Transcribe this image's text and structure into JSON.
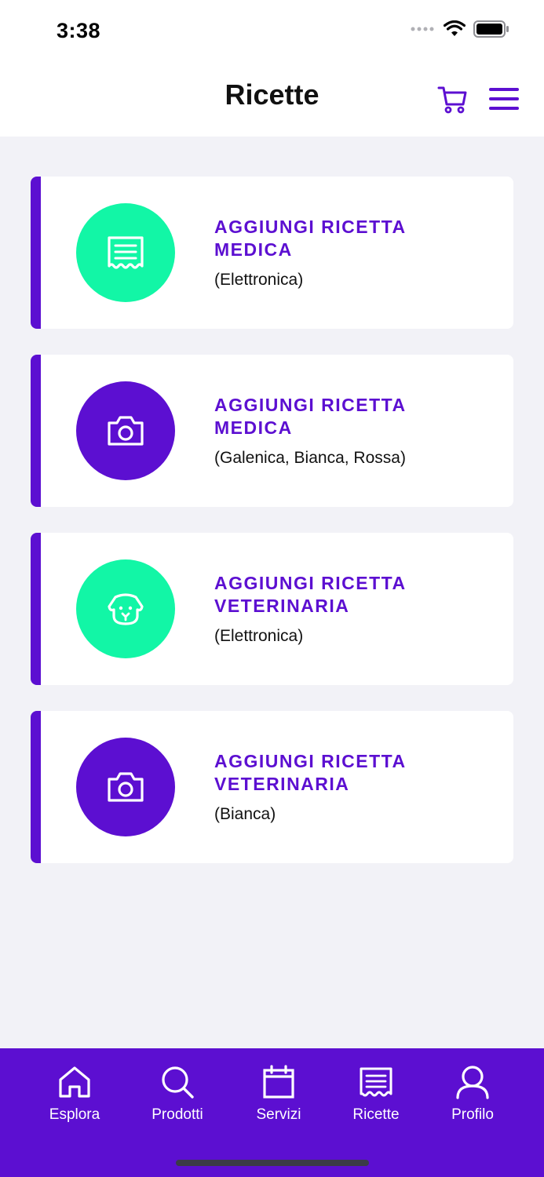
{
  "status_bar": {
    "time": "3:38"
  },
  "header": {
    "title": "Ricette",
    "cart_icon": "cart-icon",
    "menu_icon": "hamburger-menu-icon"
  },
  "colors": {
    "accent": "#5c0fd1",
    "green": "#12f6a6",
    "background": "#f2f2f7"
  },
  "cards": [
    {
      "title": "AGGIUNGI RICETTA MEDICA",
      "subtitle": "(Elettronica)",
      "icon": "receipt-icon",
      "color": "#12f6a6"
    },
    {
      "title": "AGGIUNGI RICETTA MEDICA",
      "subtitle": "(Galenica, Bianca, Rossa)",
      "icon": "camera-icon",
      "color": "#5c0fd1"
    },
    {
      "title": "AGGIUNGI RICETTA VETERINARIA",
      "subtitle": "(Elettronica)",
      "icon": "dog-icon",
      "color": "#12f6a6"
    },
    {
      "title": "AGGIUNGI RICETTA VETERINARIA",
      "subtitle": "(Bianca)",
      "icon": "camera-icon",
      "color": "#5c0fd1"
    }
  ],
  "tabbar": {
    "items": [
      {
        "label": "Esplora",
        "icon": "home-icon"
      },
      {
        "label": "Prodotti",
        "icon": "search-icon"
      },
      {
        "label": "Servizi",
        "icon": "calendar-icon"
      },
      {
        "label": "Ricette",
        "icon": "receipt-icon"
      },
      {
        "label": "Profilo",
        "icon": "user-icon"
      }
    ]
  }
}
